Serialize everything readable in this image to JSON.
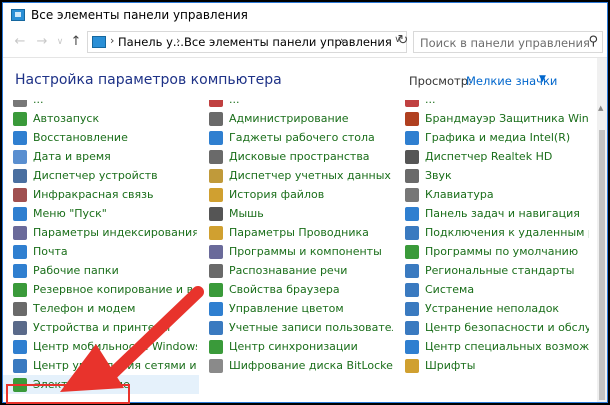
{
  "window": {
    "title": "Все элементы панели управления"
  },
  "address": {
    "crumbs": [
      "Панель у...",
      "Все элементы панели управления"
    ],
    "search_placeholder": "Поиск в панели управления"
  },
  "header": {
    "title": "Настройка параметров компьютера",
    "view_label": "Просмотр:",
    "view_value": "Мелкие значки"
  },
  "columns": [
    {
      "items": [
        {
          "label": "...",
          "icon": "#777777"
        },
        {
          "label": "Автозапуск",
          "icon": "#3a9a3a"
        },
        {
          "label": "Восстановление",
          "icon": "#2f7fd0"
        },
        {
          "label": "Дата и время",
          "icon": "#5a8fd0"
        },
        {
          "label": "Диспетчер устройств",
          "icon": "#4a6fa0"
        },
        {
          "label": "Инфракрасная связь",
          "icon": "#a05050"
        },
        {
          "label": "Меню \"Пуск\"",
          "icon": "#2f7fd0"
        },
        {
          "label": "Параметры индексирования",
          "icon": "#6a6a9a"
        },
        {
          "label": "Почта",
          "icon": "#2f7fd0"
        },
        {
          "label": "Рабочие папки",
          "icon": "#2f7fd0"
        },
        {
          "label": "Резервное копирование и восстановление",
          "icon": "#3a9a3a"
        },
        {
          "label": "Телефон и модем",
          "icon": "#6a6a6a"
        },
        {
          "label": "Устройства и принтеры",
          "icon": "#5a6a8a"
        },
        {
          "label": "Центр мобильности Windows",
          "icon": "#2f7fd0"
        },
        {
          "label": "Центр управления сетями и общим доступом",
          "icon": "#3a7ac0"
        },
        {
          "label": "Электропитание",
          "icon": "#3a9a3a"
        }
      ]
    },
    {
      "items": [
        {
          "label": "...",
          "icon": "#c04040"
        },
        {
          "label": "Администрирование",
          "icon": "#6a6a6a"
        },
        {
          "label": "Гаджеты рабочего стола",
          "icon": "#2f7fd0"
        },
        {
          "label": "Дисковые пространства",
          "icon": "#6a6a6a"
        },
        {
          "label": "Диспетчер учетных данных",
          "icon": "#c09a3a"
        },
        {
          "label": "История файлов",
          "icon": "#d0a030"
        },
        {
          "label": "Мышь",
          "icon": "#555555"
        },
        {
          "label": "Параметры Проводника",
          "icon": "#d0a030"
        },
        {
          "label": "Программы и компоненты",
          "icon": "#6a6a9a"
        },
        {
          "label": "Распознавание речи",
          "icon": "#6a6a6a"
        },
        {
          "label": "Свойства браузера",
          "icon": "#3a9a3a"
        },
        {
          "label": "Управление цветом",
          "icon": "#2f7fd0"
        },
        {
          "label": "Учетные записи пользователей",
          "icon": "#3a7ac0"
        },
        {
          "label": "Центр синхронизации",
          "icon": "#3a9a3a"
        },
        {
          "label": "Шифрование диска BitLocker",
          "icon": "#8a8a8a"
        }
      ]
    },
    {
      "items": [
        {
          "label": "...",
          "icon": "#c04040"
        },
        {
          "label": "Брандмауэр Защитника Windows",
          "icon": "#b04020"
        },
        {
          "label": "Графика и медиа Intel(R)",
          "icon": "#2f7fd0"
        },
        {
          "label": "Диспетчер Realtek HD",
          "icon": "#555555"
        },
        {
          "label": "Звук",
          "icon": "#6a6a6a"
        },
        {
          "label": "Клавиатура",
          "icon": "#777777"
        },
        {
          "label": "Панель задач и навигация",
          "icon": "#2f7fd0"
        },
        {
          "label": "Подключения к удаленным рабочим столам",
          "icon": "#3a7ac0"
        },
        {
          "label": "Программы по умолчанию",
          "icon": "#3a9a3a"
        },
        {
          "label": "Региональные стандарты",
          "icon": "#3a7ac0"
        },
        {
          "label": "Система",
          "icon": "#3a7ac0"
        },
        {
          "label": "Устранение неполадок",
          "icon": "#3a7ac0"
        },
        {
          "label": "Центр безопасности и обслуживания",
          "icon": "#3a7ac0"
        },
        {
          "label": "Центр специальных возможностей",
          "icon": "#2f7fd0"
        },
        {
          "label": "Шрифты",
          "icon": "#d0a030"
        }
      ]
    }
  ],
  "colors": {
    "accent": "#e8332c",
    "link": "#1a6e1a",
    "heading": "#1e3287"
  }
}
